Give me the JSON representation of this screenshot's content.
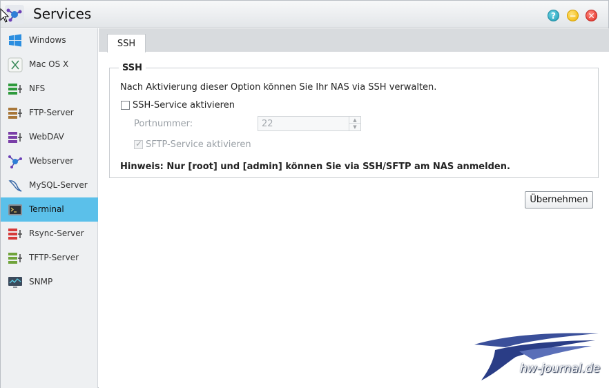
{
  "window": {
    "title": "Services",
    "controls": [
      {
        "name": "help",
        "glyph": "?"
      },
      {
        "name": "minimize",
        "glyph": "−"
      },
      {
        "name": "close",
        "glyph": "✕"
      }
    ]
  },
  "sidebar": {
    "items": [
      {
        "label": "Windows",
        "icon": "windows-icon"
      },
      {
        "label": "Mac OS X",
        "icon": "mac-finder-icon"
      },
      {
        "label": "NFS",
        "icon": "nfs-icon"
      },
      {
        "label": "FTP-Server",
        "icon": "ftp-server-icon"
      },
      {
        "label": "WebDAV",
        "icon": "webdav-icon"
      },
      {
        "label": "Webserver",
        "icon": "webserver-icon"
      },
      {
        "label": "MySQL-Server",
        "icon": "mysql-dolphin-icon"
      },
      {
        "label": "Terminal",
        "icon": "terminal-icon",
        "active": true
      },
      {
        "label": "Rsync-Server",
        "icon": "rsync-server-icon"
      },
      {
        "label": "TFTP-Server",
        "icon": "tftp-server-icon"
      },
      {
        "label": "SNMP",
        "icon": "snmp-icon"
      }
    ]
  },
  "tabs": [
    {
      "label": "SSH",
      "active": true
    }
  ],
  "ssh_group": {
    "legend": "SSH",
    "description": "Nach Aktivierung dieser Option können Sie Ihr NAS via SSH verwalten.",
    "ssh_service": {
      "label": "SSH-Service aktivieren",
      "checked": false
    },
    "port": {
      "label": "Portnummer:",
      "value": "22",
      "disabled": true
    },
    "sftp_service": {
      "label": "SFTP-Service aktivieren",
      "checked": true,
      "disabled": true
    },
    "hint": "Hinweis: Nur [root] und [admin] können Sie via SSH/SFTP am NAS anmelden."
  },
  "apply_button": {
    "label": "Übernehmen"
  },
  "watermark": {
    "text": "hw-journal.de"
  },
  "colors": {
    "active_item": "#5bc0ea",
    "help": "#1e9bb4",
    "minimize": "#f0b400",
    "close": "#e02d24"
  }
}
